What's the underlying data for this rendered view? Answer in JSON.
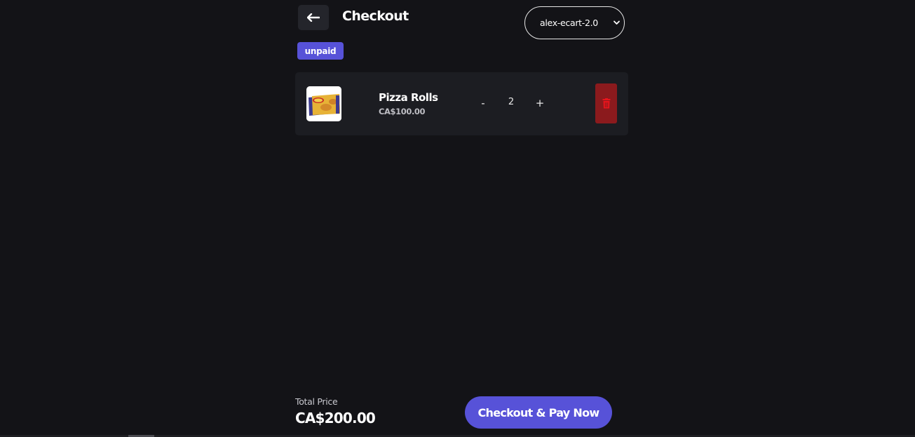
{
  "header": {
    "title": "Checkout",
    "back_icon": "arrow-left-icon"
  },
  "account_select": {
    "value": "alex-ecart-2.0",
    "chevron_icon": "chevron-down-icon"
  },
  "order": {
    "status": "unpaid"
  },
  "cart": {
    "items": [
      {
        "name": "Pizza Rolls",
        "price": "CA$100.00",
        "quantity": "2",
        "minus_label": "-",
        "plus_label": "+",
        "delete_icon": "trash-icon"
      }
    ]
  },
  "summary": {
    "total_label": "Total Price",
    "total_value": "CA$200.00",
    "checkout_label": "Checkout & Pay Now"
  },
  "colors": {
    "background": "#131317",
    "card": "#1c1d22",
    "accent": "#5752d8",
    "danger": "#8b1a1d",
    "danger_icon": "#e8141c"
  }
}
